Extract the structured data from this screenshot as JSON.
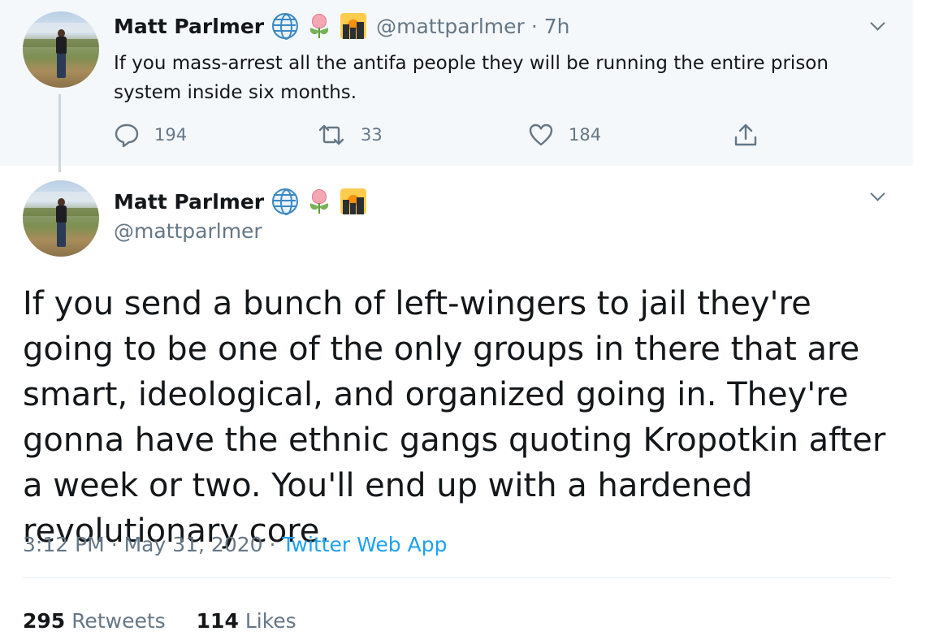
{
  "parent_tweet": {
    "name": "Matt Parlmer",
    "handle": "@mattparlmer",
    "separator": "·",
    "age": "7h",
    "text": "If you mass-arrest all the antifa people they will be running the entire prison system inside six months.",
    "replies": "194",
    "retweets": "33",
    "likes": "184",
    "name_emojis": [
      "globe-icon",
      "tulip-icon",
      "sunrise-over-city-icon"
    ]
  },
  "main_tweet": {
    "name": "Matt Parlmer",
    "handle": "@mattparlmer",
    "text": "If you send a bunch of left-wingers to jail they're going to be one of the only groups in there that are smart, ideological, and organized going in. They're gonna have the ethnic gangs quoting Kropotkin after a week or two. You'll end up with a hardened revolutionary core.",
    "time": "3:12 PM",
    "sep1": "·",
    "date": "May 31, 2020",
    "sep2": "·",
    "source": "Twitter Web App",
    "retweets_count": "295",
    "retweets_label": "Retweets",
    "likes_count": "114",
    "likes_label": "Likes"
  },
  "colors": {
    "parent_background": "#f5f8fa",
    "secondary_text": "#657786",
    "link": "#1da1f2",
    "primary_text": "#14171a",
    "thread_line": "#ccd6dd"
  }
}
